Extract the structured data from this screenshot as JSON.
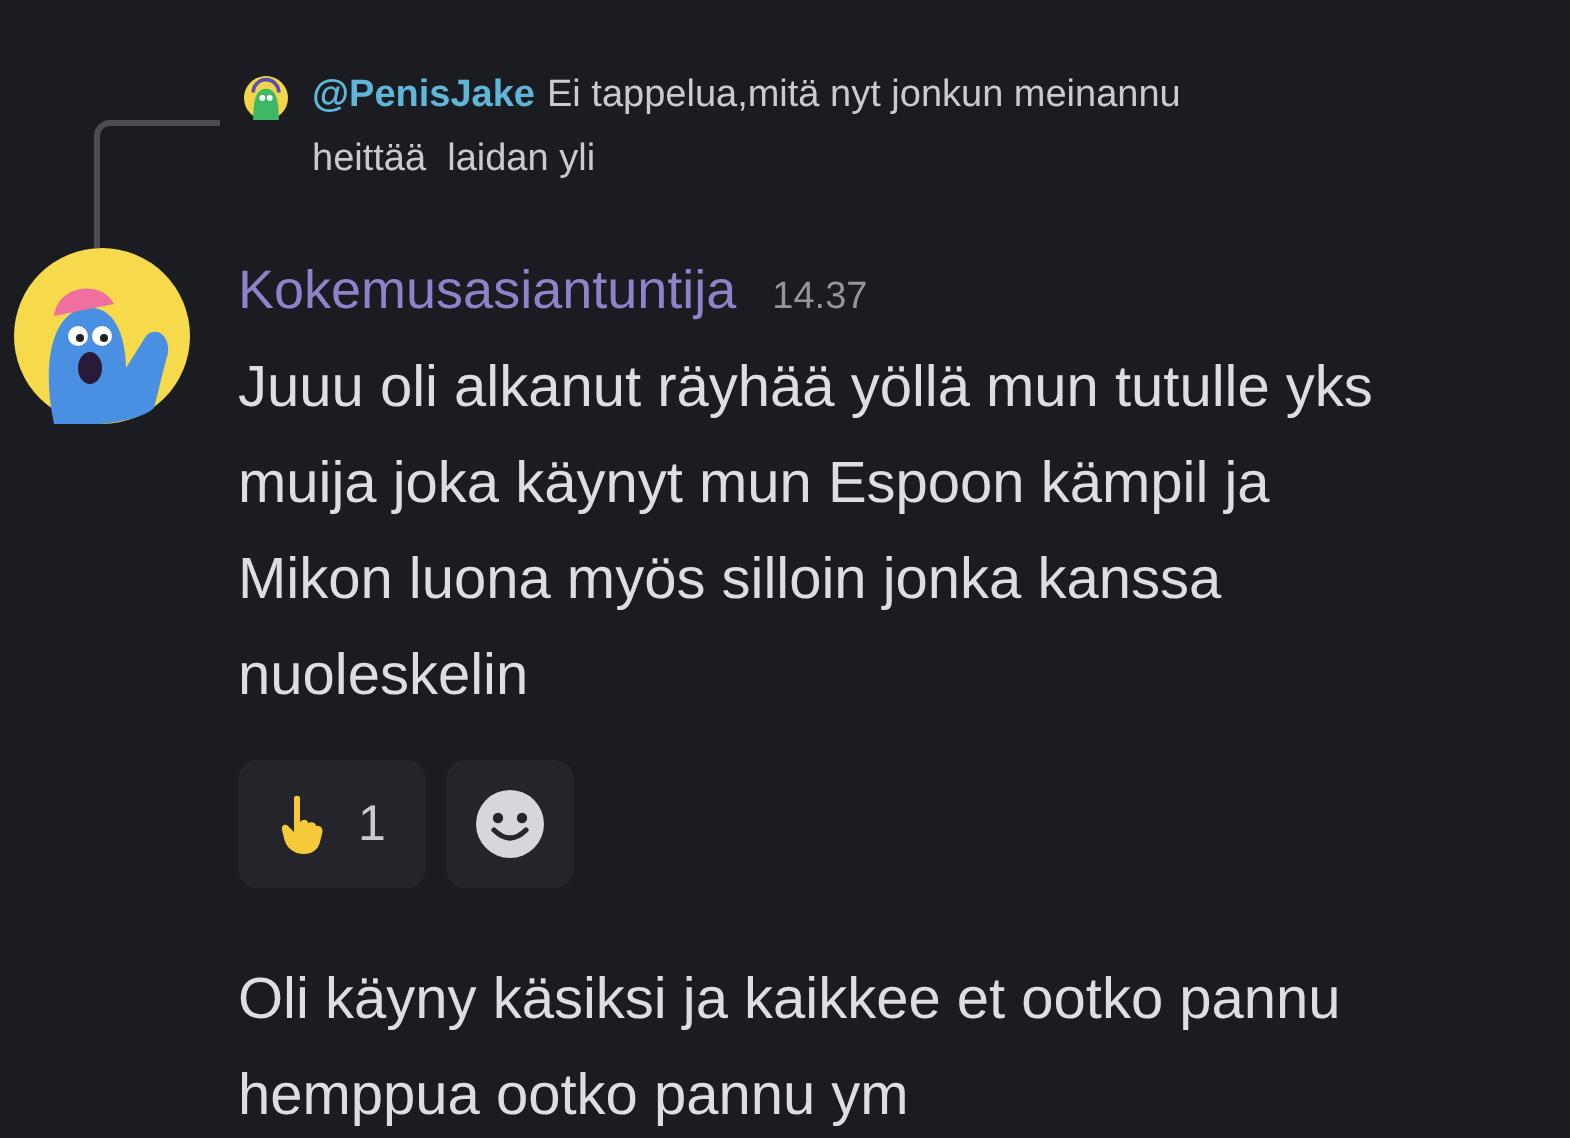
{
  "reply": {
    "author": "@PenisJake",
    "text_lines": [
      "Ei tappelua,mitä nyt jonkun meinannu",
      "heittää  laidan yli"
    ]
  },
  "message": {
    "author": "Kokemusasiantuntija",
    "timestamp": "14.37",
    "lines": [
      "Juuu oli alkanut räyhää yöllä mun tutulle yks",
      "muija joka käynyt mun Espoon kämpil ja",
      "Mikon luona myös silloin jonka kanssa",
      "nuoleskelin"
    ]
  },
  "reactions": [
    {
      "count": "1",
      "selected": false
    }
  ],
  "followup": {
    "lines": [
      "Oli käyny käsiksi ja kaikkee et ootko pannu",
      "hemppua ootko pannu ym"
    ]
  }
}
